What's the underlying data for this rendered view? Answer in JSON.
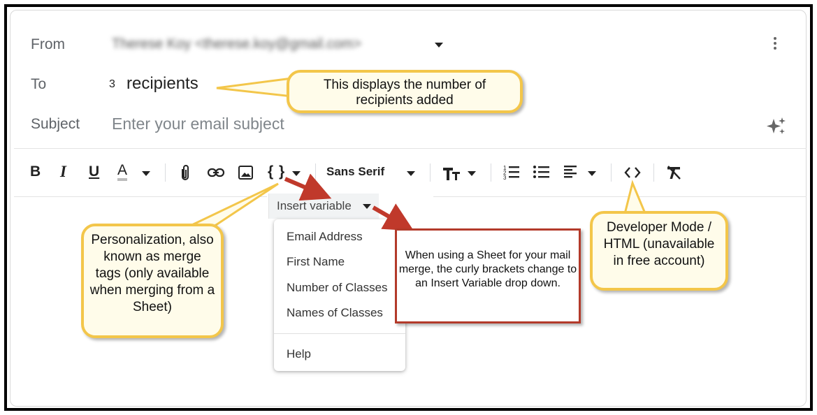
{
  "compose": {
    "from_label": "From",
    "from_value": "Therese Koy <therese.koy@gmail.com>",
    "to_label": "To",
    "to_count": "3",
    "to_text": "recipients",
    "subject_label": "Subject",
    "subject_placeholder": "Enter your email subject"
  },
  "toolbar": {
    "bold": "B",
    "italic": "I",
    "underline": "U",
    "text_color": "A",
    "merge_tags": "{ }",
    "font_family": "Sans Serif",
    "icons": [
      "bold-icon",
      "italic-icon",
      "underline-icon",
      "text-color-icon",
      "attachment-icon",
      "link-icon",
      "image-icon",
      "curly-brackets-icon",
      "font-size-icon",
      "numbered-list-icon",
      "bulleted-list-icon",
      "align-icon",
      "code-icon",
      "clear-formatting-icon"
    ]
  },
  "insert_variable": {
    "label": "Insert variable",
    "items": [
      "Email Address",
      "First Name",
      "Number of Classes",
      "Names of Classes"
    ],
    "help": "Help"
  },
  "annotations": {
    "recipients": "This displays the number of recipients added",
    "personalization": "Personalization, also known as merge tags (only available when merging from a Sheet)",
    "sheet_note": "When using a Sheet for your mail merge, the curly brackets change to an Insert Variable drop down.",
    "developer": "Developer Mode / HTML (unavailable in free account)"
  },
  "colors": {
    "callout_fill": "#fffcea",
    "callout_border": "#f3c64a",
    "note_border": "#b33a2a",
    "arrow": "#c0392b"
  }
}
